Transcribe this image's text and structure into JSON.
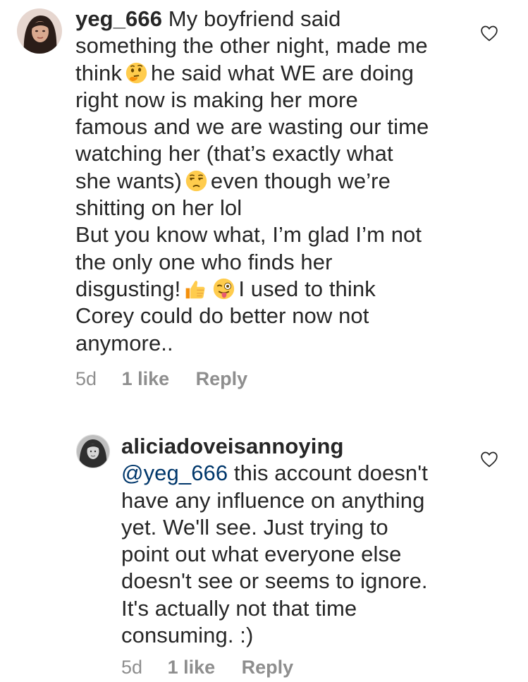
{
  "comments": [
    {
      "username": "yeg_666",
      "lines": [
        " My boyfriend said",
        "something the other night, made me",
        "think",
        "he said what WE are doing",
        "right now is making her more",
        "famous and we are wasting our time",
        "watching her (that’s exactly what",
        "she wants)",
        "even though we’re",
        "shitting on her lol",
        "But you know what, I’m glad I’m not",
        "the only one who finds her",
        "disgusting!",
        "I used to think",
        "Corey could do better now not",
        "anymore.."
      ],
      "emojis": [
        "thinking-face",
        "unamused-face",
        "thumbs-up",
        "winking-face-with-tongue"
      ],
      "time": "5d",
      "likes": "1 like",
      "reply": "Reply"
    },
    {
      "username": "aliciadoveisannoying",
      "mention": "@yeg_666",
      "lines": [
        " this account doesn't",
        "have any influence on anything",
        "yet. We'll see. Just trying to",
        "point out what everyone else",
        "doesn't see or seems to ignore.",
        "It's actually not that time",
        "consuming. :)"
      ],
      "time": "5d",
      "likes": "1 like",
      "reply": "Reply"
    }
  ],
  "colors": {
    "text": "#262626",
    "meta": "#8e8e8e",
    "mention": "#00376b",
    "emoji_yellow": "#FFCC4D"
  }
}
